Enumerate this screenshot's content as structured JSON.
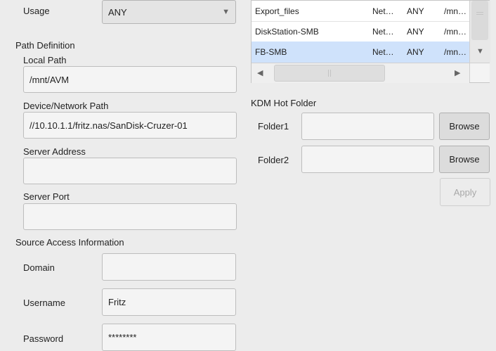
{
  "left": {
    "usage": {
      "label": "Usage",
      "value": "ANY"
    },
    "path_definition": {
      "title": "Path Definition",
      "local_path": {
        "label": "Local Path",
        "value": "/mnt/AVM"
      },
      "network_path": {
        "label": "Device/Network Path",
        "value": "//10.10.1.1/fritz.nas/SanDisk-Cruzer-01"
      },
      "server_address": {
        "label": "Server Address",
        "value": ""
      },
      "server_port": {
        "label": "Server Port",
        "value": ""
      }
    },
    "source_access": {
      "title": "Source Access Information",
      "domain": {
        "label": "Domain",
        "value": ""
      },
      "username": {
        "label": "Username",
        "value": "Fritz"
      },
      "password": {
        "label": "Password",
        "value": "********"
      }
    }
  },
  "table": {
    "rows": [
      {
        "name": "Export_files",
        "type": "Net…",
        "usage": "ANY",
        "path": "/mn…",
        "selected": false
      },
      {
        "name": "DiskStation-SMB",
        "type": "Net…",
        "usage": "ANY",
        "path": "/mn…",
        "selected": false
      },
      {
        "name": "FB-SMB",
        "type": "Net…",
        "usage": "ANY",
        "path": "/mn…",
        "selected": true
      }
    ]
  },
  "kdm": {
    "title": "KDM Hot Folder",
    "folder1": {
      "label": "Folder1",
      "value": "",
      "browse": "Browse"
    },
    "folder2": {
      "label": "Folder2",
      "value": "",
      "browse": "Browse"
    },
    "apply": "Apply"
  },
  "colors": {
    "selected_row": "#cfe2fb",
    "background": "#ececec"
  },
  "icons": {
    "dropdown": "triangle-down",
    "scroll_left": "triangle-left",
    "scroll_right": "triangle-right",
    "scroll_down": "triangle-down"
  }
}
